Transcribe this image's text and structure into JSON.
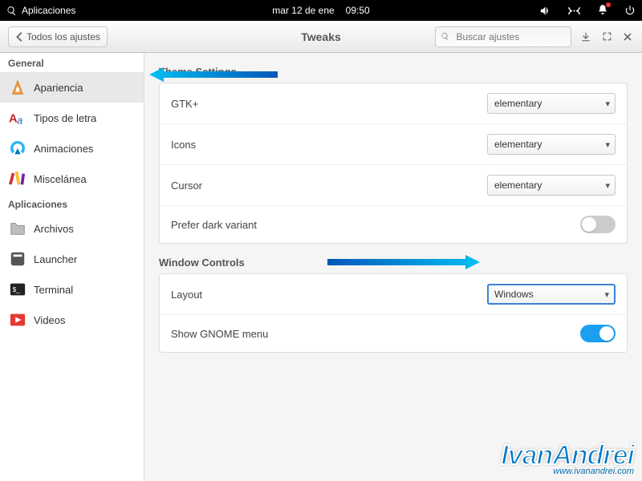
{
  "panel": {
    "apps_label": "Aplicaciones",
    "date": "mar 12 de ene",
    "time": "09:50"
  },
  "header": {
    "back_label": "Todos los ajustes",
    "title": "Tweaks",
    "search_placeholder": "Buscar ajustes"
  },
  "sidebar": {
    "groups": [
      {
        "title": "General",
        "items": [
          {
            "key": "apariencia",
            "label": "Apariencia",
            "selected": true
          },
          {
            "key": "tipos-letra",
            "label": "Tipos de letra"
          },
          {
            "key": "animaciones",
            "label": "Animaciones"
          },
          {
            "key": "miscelanea",
            "label": "Miscelánea"
          }
        ]
      },
      {
        "title": "Aplicaciones",
        "items": [
          {
            "key": "archivos",
            "label": "Archivos"
          },
          {
            "key": "launcher",
            "label": "Launcher"
          },
          {
            "key": "terminal",
            "label": "Terminal"
          },
          {
            "key": "videos",
            "label": "Videos"
          }
        ]
      }
    ]
  },
  "content": {
    "section1_title": "Theme Settings",
    "section2_title": "Window Controls",
    "gtk_label": "GTK+",
    "gtk_value": "elementary",
    "icons_label": "Icons",
    "icons_value": "elementary",
    "cursor_label": "Cursor",
    "cursor_value": "elementary",
    "dark_label": "Prefer dark variant",
    "dark_on": false,
    "layout_label": "Layout",
    "layout_value": "Windows",
    "gnome_label": "Show GNOME menu",
    "gnome_on": true
  },
  "watermark": {
    "name": "IvanAndrei",
    "url": "www.ivanandrei.com"
  }
}
